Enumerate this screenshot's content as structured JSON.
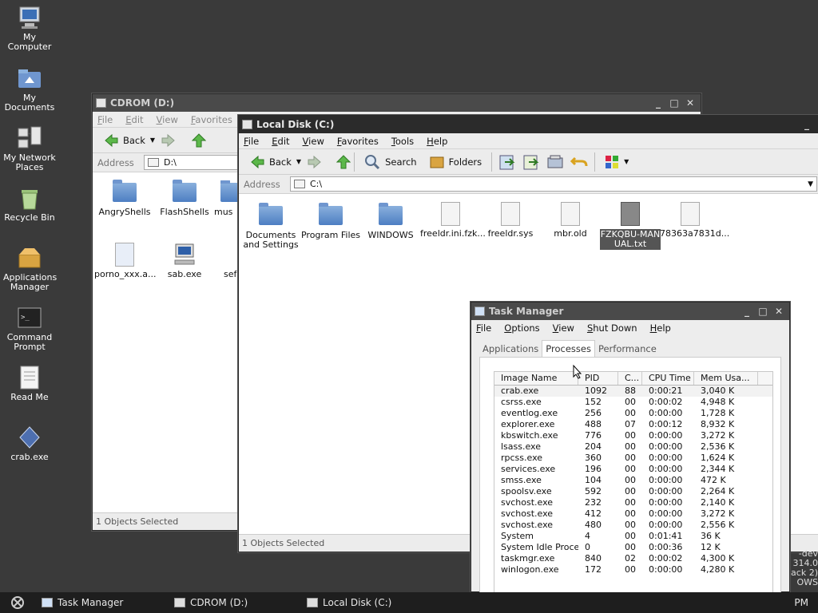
{
  "desktop": {
    "icons": [
      {
        "label": "My Computer",
        "icon": "computer-icon"
      },
      {
        "label": "My Documents",
        "icon": "documents-folder-icon"
      },
      {
        "label": "My Network Places",
        "icon": "network-icon"
      },
      {
        "label": "Recycle Bin",
        "icon": "recycle-bin-icon"
      },
      {
        "label": "Applications Manager",
        "icon": "applications-icon"
      },
      {
        "label": "Command Prompt",
        "icon": "terminal-icon"
      },
      {
        "label": "Read Me",
        "icon": "text-document-icon"
      },
      {
        "label": "crab.exe",
        "icon": "crab-exe-icon"
      }
    ]
  },
  "cdrom_window": {
    "title": "CDROM (D:)",
    "menu": [
      "File",
      "Edit",
      "View",
      "Favorites"
    ],
    "back_label": "Back",
    "address_label": "Address",
    "address_value": "D:\\",
    "files": [
      "AngryShells",
      "FlashShells",
      "mus",
      "porno_xxx.a...",
      "sab.exe",
      "sef"
    ],
    "status": "1 Objects Selected"
  },
  "localdisk_window": {
    "title": "Local Disk (C:)",
    "menu": [
      "File",
      "Edit",
      "View",
      "Favorites",
      "Tools",
      "Help"
    ],
    "toolbar": {
      "back": "Back",
      "search": "Search",
      "folders": "Folders"
    },
    "address_label": "Address",
    "address_value": "C:\\",
    "files": [
      {
        "name": "Documents and Settings",
        "kind": "folder"
      },
      {
        "name": "Program Files",
        "kind": "folder"
      },
      {
        "name": "WINDOWS",
        "kind": "folder"
      },
      {
        "name": "freeldr.ini.fzk...",
        "kind": "file"
      },
      {
        "name": "freeldr.sys",
        "kind": "file"
      },
      {
        "name": "mbr.old",
        "kind": "file"
      },
      {
        "name": "FZKQBU-MANUAL.txt",
        "kind": "file"
      },
      {
        "name": "78363a7831d...",
        "kind": "file"
      }
    ],
    "status": "1 Objects Selected"
  },
  "task_manager": {
    "title": "Task Manager",
    "menu": [
      "File",
      "Options",
      "View",
      "Shut Down",
      "Help"
    ],
    "tabs": [
      "Applications",
      "Processes",
      "Performance"
    ],
    "active_tab": "Processes",
    "columns": [
      "Image Name",
      "PID",
      "C...",
      "CPU Time",
      "Mem Usa..."
    ],
    "processes": [
      [
        "crab.exe",
        "1092",
        "88",
        "0:00:21",
        "3,040 K"
      ],
      [
        "csrss.exe",
        "152",
        "00",
        "0:00:02",
        "4,948 K"
      ],
      [
        "eventlog.exe",
        "256",
        "00",
        "0:00:00",
        "1,728 K"
      ],
      [
        "explorer.exe",
        "488",
        "07",
        "0:00:12",
        "8,932 K"
      ],
      [
        "kbswitch.exe",
        "776",
        "00",
        "0:00:00",
        "3,272 K"
      ],
      [
        "lsass.exe",
        "204",
        "00",
        "0:00:00",
        "2,536 K"
      ],
      [
        "rpcss.exe",
        "360",
        "00",
        "0:00:00",
        "1,624 K"
      ],
      [
        "services.exe",
        "196",
        "00",
        "0:00:00",
        "2,344 K"
      ],
      [
        "smss.exe",
        "104",
        "00",
        "0:00:00",
        "472 K"
      ],
      [
        "spoolsv.exe",
        "592",
        "00",
        "0:00:00",
        "2,264 K"
      ],
      [
        "svchost.exe",
        "232",
        "00",
        "0:00:00",
        "2,140 K"
      ],
      [
        "svchost.exe",
        "412",
        "00",
        "0:00:00",
        "3,272 K"
      ],
      [
        "svchost.exe",
        "480",
        "00",
        "0:00:00",
        "2,556 K"
      ],
      [
        "System",
        "4",
        "00",
        "0:01:41",
        "36 K"
      ],
      [
        "System Idle Process",
        "0",
        "00",
        "0:00:36",
        "12 K"
      ],
      [
        "taskmgr.exe",
        "840",
        "02",
        "0:00:02",
        "4,300 K"
      ],
      [
        "winlogon.exe",
        "172",
        "00",
        "0:00:00",
        "4,280 K"
      ]
    ]
  },
  "taskbar": {
    "items": [
      "Task Manager",
      "CDROM (D:)",
      "Local Disk (C:)"
    ],
    "clock": "PM"
  },
  "watermark": {
    "line1": "-dev",
    "line2": "314.0",
    "line3": "ack 2)",
    "line4": "OWS"
  }
}
